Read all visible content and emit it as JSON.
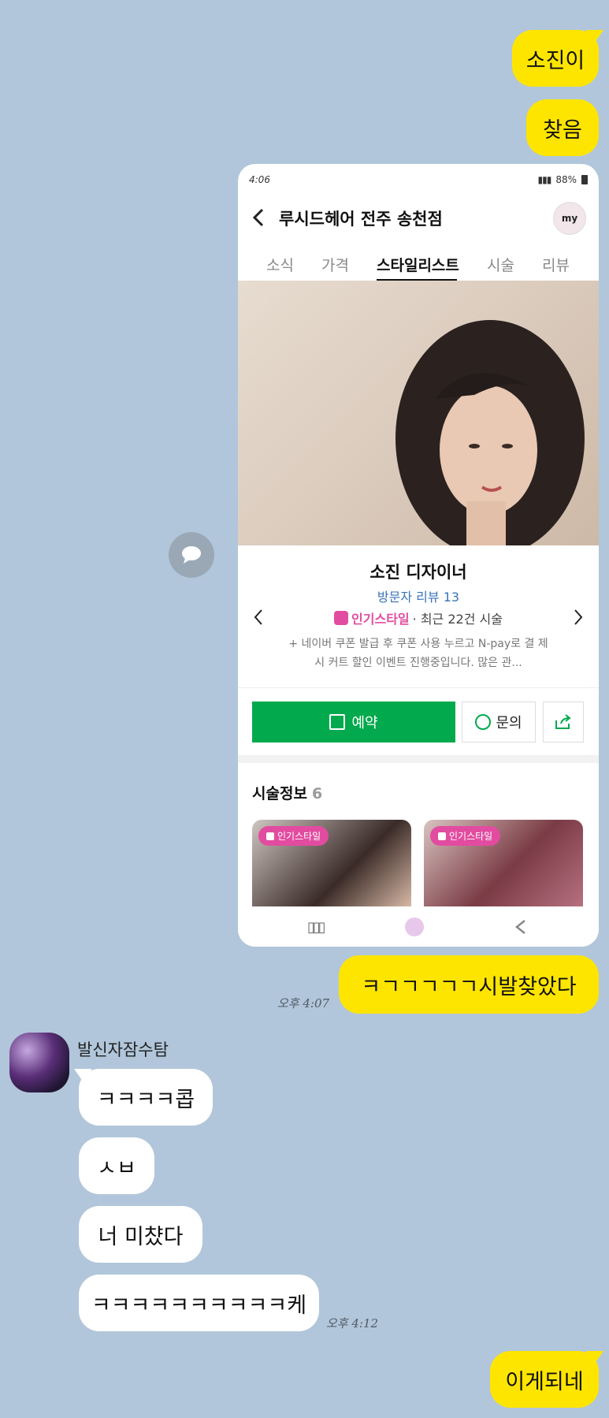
{
  "messages_top": [
    {
      "text": "소진이"
    },
    {
      "text": "찾음"
    }
  ],
  "shot": {
    "status_time": "4:06",
    "status_right": "88%",
    "shop_title": "루시드헤어 전주 송천점",
    "avatar_label": "my",
    "tabs": [
      "소식",
      "가격",
      "스타일리스트",
      "시술",
      "리뷰"
    ],
    "designer_name": "소진 디자이너",
    "visitor_review": "방문자 리뷰 13",
    "popular_style_label": "인기스타일",
    "recent_count": "· 최근 22건 시술",
    "promo_line1": "+ 네이버 쿠폰 발급 후 쿠폰 사용 누르고 N-pay로 결 제",
    "promo_line2": "시 커트 할인 이벤트 진행중입니다. 많은 관...",
    "reserve_label": "예약",
    "inquiry_label": "문의",
    "section_title": "시술정보",
    "section_count": "6",
    "card_chip_1": "인기스타일",
    "card_chip_2": "인기스타일"
  },
  "message_after_shot": {
    "text": "ㅋㄱㄱㄱㄱㄱ시발찾았다",
    "time": "오후 4:07"
  },
  "other": {
    "name": "발신자잠수탐",
    "messages": [
      {
        "text": "ㅋㅋㅋㅋ콥"
      },
      {
        "text": "ㅅㅂ"
      },
      {
        "text": "너 미챴다"
      },
      {
        "text": "ㅋㅋㅋㅋㅋㅋㅋㅋㅋㅋ케"
      }
    ],
    "time": "오후 4:12"
  },
  "message_last": {
    "text": "이게되네"
  },
  "colors": {
    "background": "#b1c6da",
    "my_bubble": "#fee500",
    "their_bubble": "#ffffff",
    "naver_green": "#03a94d",
    "pink": "#e24ca0"
  }
}
